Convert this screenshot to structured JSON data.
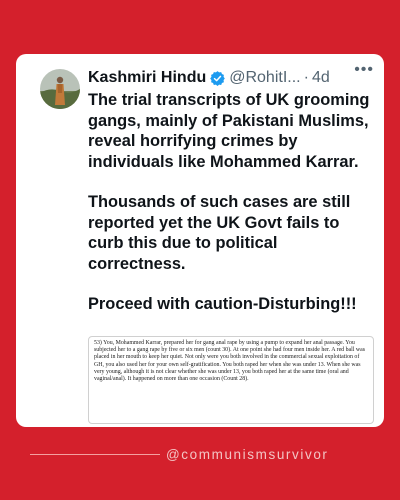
{
  "post": {
    "display_name": "Kashmiri Hindu",
    "handle": "@RohitI...",
    "separator": "·",
    "time": "4d",
    "more_icon": "more-horizontal-icon",
    "verified_icon": "verified-badge-icon",
    "text": {
      "p1": "The trial transcripts of UK grooming gangs, mainly of Pakistani Muslims, reveal horrifying crimes by individuals like Mohammed Karrar.",
      "p2": "Thousands of such cases are still reported yet the UK Govt fails to curb this due to political correctness.",
      "p3": "Proceed with caution-Disturbing!!!"
    },
    "excerpt": "53)  You, Mohammed Karrar, prepared her for gang anal rape by using a pump to expand her anal passage.  You subjected her to a gang rape by five or six men (count 30). At one point she had four men inside her. A red ball was placed in her mouth to keep her quiet. Not only were you both involved in the commercial sexual exploitation of  GH, you also used her for your own self-gratification. You both raped her when she was under 13. When she was very young, although it is not clear whether she was under 13, you both raped her at the same time (oral and vaginal/anal). It happened on more than one occasion (Count 28)."
  },
  "footer": {
    "handle": "@communismsurvivor"
  },
  "colors": {
    "background": "#d4202c",
    "card": "#ffffff",
    "verified": "#1d9bf0"
  }
}
